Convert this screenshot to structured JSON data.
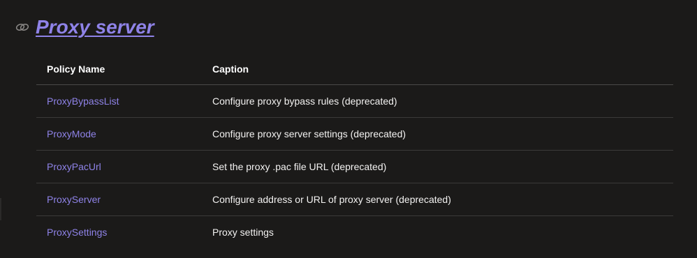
{
  "section": {
    "icon": "link-icon",
    "title": "Proxy server"
  },
  "table": {
    "headers": {
      "policy_name": "Policy Name",
      "caption": "Caption"
    },
    "rows": [
      {
        "name": "ProxyBypassList",
        "caption": "Configure proxy bypass rules (deprecated)"
      },
      {
        "name": "ProxyMode",
        "caption": "Configure proxy server settings (deprecated)"
      },
      {
        "name": "ProxyPacUrl",
        "caption": "Set the proxy .pac file URL (deprecated)"
      },
      {
        "name": "ProxyServer",
        "caption": "Configure address or URL of proxy server (deprecated)"
      },
      {
        "name": "ProxySettings",
        "caption": "Proxy settings"
      }
    ]
  },
  "colors": {
    "background": "#1b1a19",
    "link": "#8f83e8",
    "text": "#ffffff",
    "divider": "#3b3a39"
  }
}
